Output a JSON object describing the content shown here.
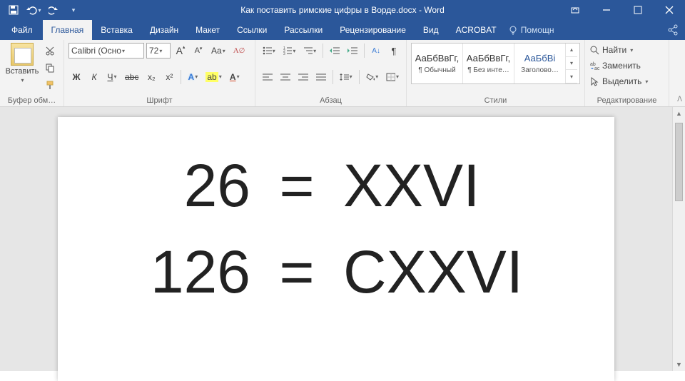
{
  "title": "Как поставить римские цифры в Ворде.docx - Word",
  "qat": {
    "save": "save",
    "undo": "undo",
    "redo": "redo",
    "customize": "▾"
  },
  "win": {
    "opts": "ribbon-options",
    "min": "minimize",
    "max": "restore",
    "close": "close"
  },
  "tabs": {
    "file": "Файл",
    "home": "Главная",
    "insert": "Вставка",
    "design": "Дизайн",
    "layout": "Макет",
    "references": "Ссылки",
    "mailings": "Рассылки",
    "review": "Рецензирование",
    "view": "Вид",
    "acrobat": "ACROBAT",
    "tell": "Помощн"
  },
  "clipboard": {
    "paste": "Вставить",
    "label": "Буфер обм…"
  },
  "font": {
    "name": "Calibri (Осно",
    "size": "72",
    "grow": "A",
    "shrink": "A",
    "case": "Aa",
    "clear": "⌫",
    "bold": "Ж",
    "italic": "К",
    "underline": "Ч",
    "strike": "abc",
    "sub": "x₂",
    "sup": "x²",
    "effects": "A",
    "highlight": "✎",
    "color": "A",
    "label": "Шрифт"
  },
  "para": {
    "label": "Абзац"
  },
  "styles": {
    "sample": "АаБбВвГг,",
    "sample_h": "АаБбВі",
    "normal": "¶ Обычный",
    "nospace": "¶ Без инте…",
    "heading1": "Заголово…",
    "label": "Стили"
  },
  "editing": {
    "find": "Найти",
    "replace": "Заменить",
    "select": "Выделить",
    "label": "Редактирование"
  },
  "doc": {
    "r1_num": "26",
    "r1_eq": "=",
    "r1_rom": "XXVI",
    "r2_num": "126",
    "r2_eq": "=",
    "r2_rom": "CXXVI"
  }
}
